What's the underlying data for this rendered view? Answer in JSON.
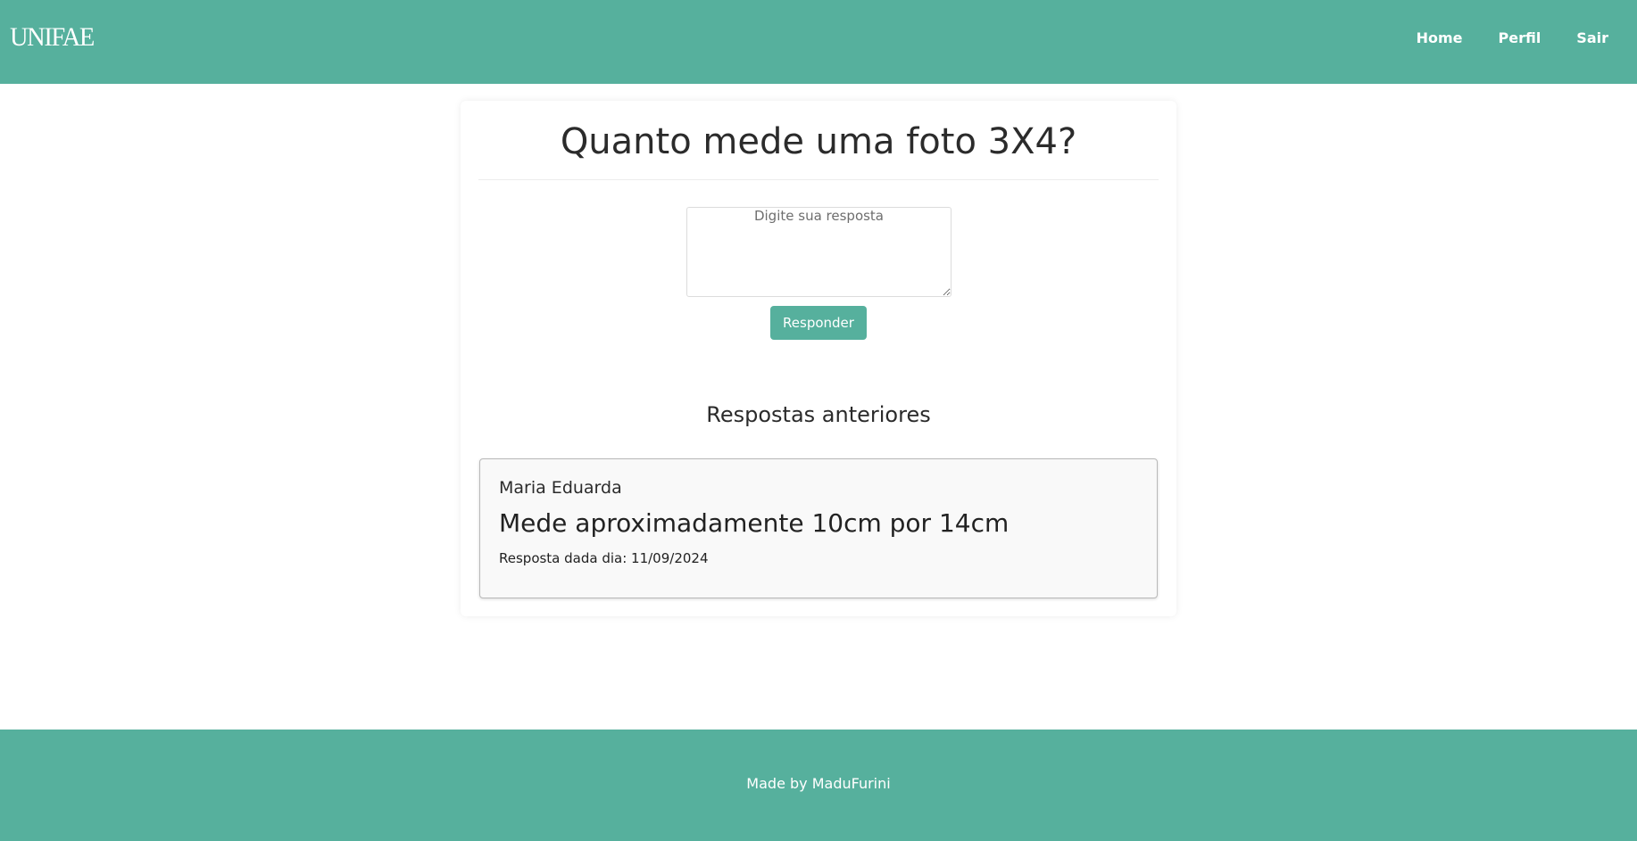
{
  "colors": {
    "brand": "#56b09d",
    "text_dark": "#2b2b2b",
    "card_item_bg": "#f9f9f9"
  },
  "navbar": {
    "logo": "UNIFAE",
    "links": [
      {
        "label": "Home"
      },
      {
        "label": "Perfil"
      },
      {
        "label": "Sair"
      }
    ]
  },
  "question": {
    "title": "Quanto mede uma foto 3X4?",
    "input_placeholder": "Digite sua resposta",
    "input_value": "",
    "submit_label": "Responder"
  },
  "previous_answers": {
    "heading": "Respostas anteriores",
    "items": [
      {
        "author": "Maria Eduarda",
        "text": "Mede aproximadamente 10cm por 14cm",
        "date_label": "Resposta dada dia: 11/09/2024"
      }
    ]
  },
  "footer": {
    "text": "Made by MaduFurini"
  }
}
